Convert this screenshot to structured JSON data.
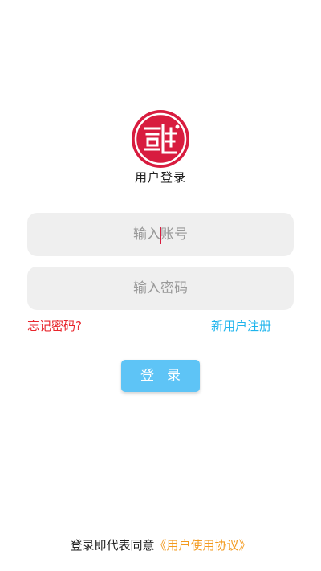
{
  "app": {
    "title": "用户登录"
  },
  "logo": {
    "icon": "seal-logo-icon",
    "color": "#d81c3f"
  },
  "form": {
    "account": {
      "placeholder": "输入账号",
      "value": ""
    },
    "password": {
      "placeholder": "输入密码",
      "value": ""
    },
    "forgot_label": "忘记密码?",
    "register_label": "新用户注册",
    "login_label": "登录"
  },
  "footer": {
    "agreement_prefix": "登录即代表同意",
    "agreement_link": "《用户使用协议》"
  },
  "colors": {
    "accent": "#5ec4f6",
    "forgot": "#e8262c",
    "register": "#1eb4ec",
    "agreement_link": "#f39a1e",
    "input_bg": "#efefef"
  }
}
